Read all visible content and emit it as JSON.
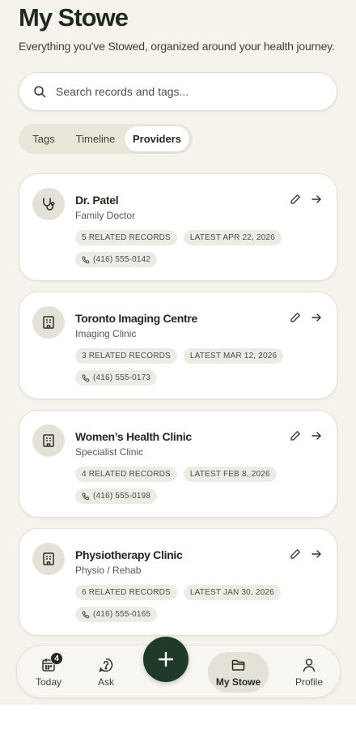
{
  "header": {
    "title": "My Stowe",
    "subtitle": "Everything you've Stowed, organized around your health journey."
  },
  "search": {
    "placeholder": "Search records and tags...",
    "icon": "search-icon"
  },
  "segments": {
    "tabs": [
      "Tags",
      "Timeline",
      "Providers"
    ],
    "selected": "Providers"
  },
  "providers": [
    {
      "name": "Dr. Patel",
      "type": "Family Doctor",
      "records": "5 RELATED RECORDS",
      "latest": "LATEST APR 22, 2026",
      "phone": "(416) 555-0142",
      "icon": "stethoscope-icon"
    },
    {
      "name": "Toronto Imaging Centre",
      "type": "Imaging Clinic",
      "records": "3 RELATED RECORDS",
      "latest": "LATEST MAR 12, 2026",
      "phone": "(416) 555-0173",
      "icon": "building-icon"
    },
    {
      "name": "Women’s Health Clinic",
      "type": "Specialist Clinic",
      "records": "4 RELATED RECORDS",
      "latest": "LATEST FEB 8, 2026",
      "phone": "(416) 555-0198",
      "icon": "building-icon"
    },
    {
      "name": "Physiotherapy Clinic",
      "type": "Physio / Rehab",
      "records": "6 RELATED RECORDS",
      "latest": "LATEST JAN 30, 2026",
      "phone": "(416) 555-0165",
      "icon": "building-icon"
    }
  ],
  "nav": {
    "today": {
      "label": "Today",
      "badge": "4",
      "icon": "calendar-icon"
    },
    "ask": {
      "label": "Ask",
      "icon": "question-icon"
    },
    "add": {
      "icon": "plus-icon"
    },
    "mystowe": {
      "label": "My Stowe",
      "icon": "folder-icon",
      "active": true
    },
    "profile": {
      "label": "Profile",
      "icon": "user-icon"
    }
  },
  "colors": {
    "background": "#f6f3ec",
    "accent": "#1f3a28",
    "chip": "#ecebe4",
    "text": "#1f2a1f"
  }
}
